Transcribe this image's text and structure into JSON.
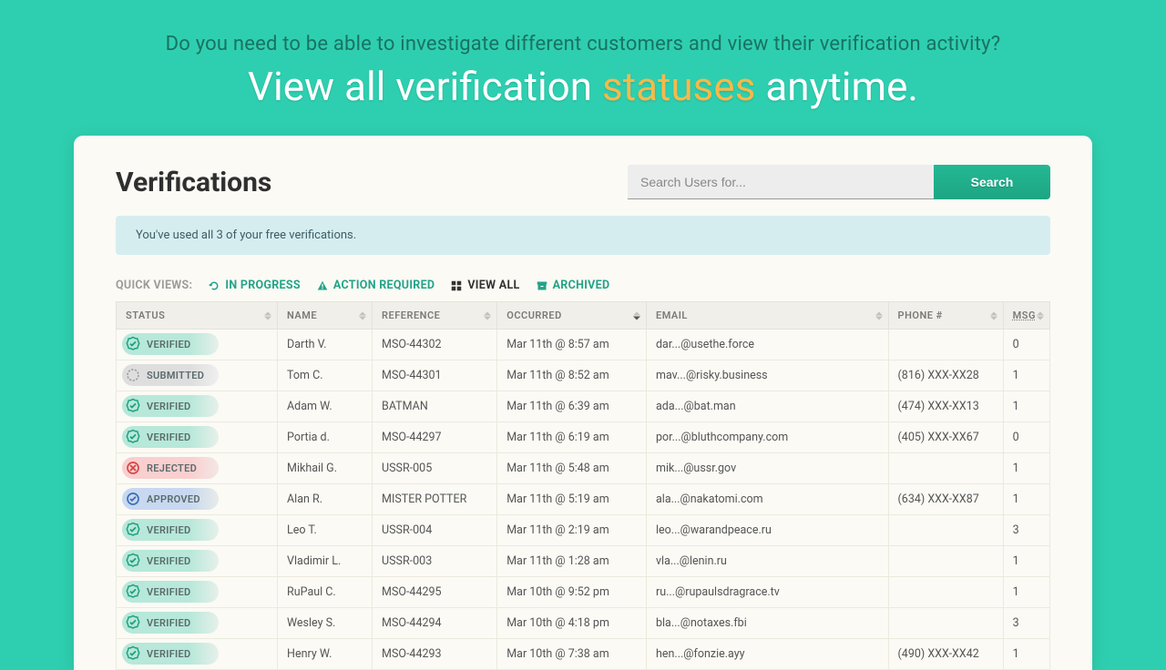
{
  "hero": {
    "subtitle": "Do you need to be able to investigate different customers and view their verification activity?",
    "main_pre": "View all verification ",
    "main_highlight": "statuses",
    "main_post": " anytime."
  },
  "page": {
    "title": "Verifications"
  },
  "search": {
    "placeholder": "Search Users for...",
    "button": "Search"
  },
  "alert": {
    "text": "You've used all 3 of your free verifications."
  },
  "quick_views": {
    "label": "QUICK VIEWS:",
    "in_progress": "IN PROGRESS",
    "action_required": "ACTION REQUIRED",
    "view_all": "VIEW ALL",
    "archived": "ARCHIVED"
  },
  "columns": {
    "status": "STATUS",
    "name": "NAME",
    "reference": "REFERENCE",
    "occurred": "OCCURRED",
    "email": "EMAIL",
    "phone": "PHONE #",
    "msg": "MSG"
  },
  "status_labels": {
    "verified": "VERIFIED",
    "submitted": "SUBMITTED",
    "rejected": "REJECTED",
    "approved": "APPROVED"
  },
  "rows": [
    {
      "status": "verified",
      "name": "Darth V.",
      "reference": "MSO-44302",
      "occurred": "Mar 11th @ 8:57 am",
      "email": "dar...@usethe.force",
      "phone": "",
      "msg": "0"
    },
    {
      "status": "submitted",
      "name": "Tom C.",
      "reference": "MSO-44301",
      "occurred": "Mar 11th @ 8:52 am",
      "email": "mav...@risky.business",
      "phone": "(816) XXX-XX28",
      "msg": "1"
    },
    {
      "status": "verified",
      "name": "Adam W.",
      "reference": "BATMAN",
      "occurred": "Mar 11th @ 6:39 am",
      "email": "ada...@bat.man",
      "phone": "(474) XXX-XX13",
      "msg": "1"
    },
    {
      "status": "verified",
      "name": "Portia d.",
      "reference": "MSO-44297",
      "occurred": "Mar 11th @ 6:19 am",
      "email": "por...@bluthcompany.com",
      "phone": "(405) XXX-XX67",
      "msg": "0"
    },
    {
      "status": "rejected",
      "name": "Mikhail G.",
      "reference": "USSR-005",
      "occurred": "Mar 11th @ 5:48 am",
      "email": "mik...@ussr.gov",
      "phone": "",
      "msg": "1"
    },
    {
      "status": "approved",
      "name": "Alan R.",
      "reference": "MISTER POTTER",
      "occurred": "Mar 11th @ 5:19 am",
      "email": "ala...@nakatomi.com",
      "phone": "(634) XXX-XX87",
      "msg": "1"
    },
    {
      "status": "verified",
      "name": "Leo T.",
      "reference": "USSR-004",
      "occurred": "Mar 11th @ 2:19 am",
      "email": "leo...@warandpeace.ru",
      "phone": "",
      "msg": "3"
    },
    {
      "status": "verified",
      "name": "Vladimir L.",
      "reference": "USSR-003",
      "occurred": "Mar 11th @ 1:28 am",
      "email": "vla...@lenin.ru",
      "phone": "",
      "msg": "1"
    },
    {
      "status": "verified",
      "name": "RuPaul C.",
      "reference": "MSO-44295",
      "occurred": "Mar 10th @ 9:52 pm",
      "email": "ru...@rupaulsdragrace.tv",
      "phone": "",
      "msg": "1"
    },
    {
      "status": "verified",
      "name": "Wesley S.",
      "reference": "MSO-44294",
      "occurred": "Mar 10th @ 4:18 pm",
      "email": "bla...@notaxes.fbi",
      "phone": "",
      "msg": "3"
    },
    {
      "status": "verified",
      "name": "Henry W.",
      "reference": "MSO-44293",
      "occurred": "Mar 10th @ 7:38 am",
      "email": "hen...@fonzie.ayy",
      "phone": "(490) XXX-XX42",
      "msg": "1"
    }
  ]
}
